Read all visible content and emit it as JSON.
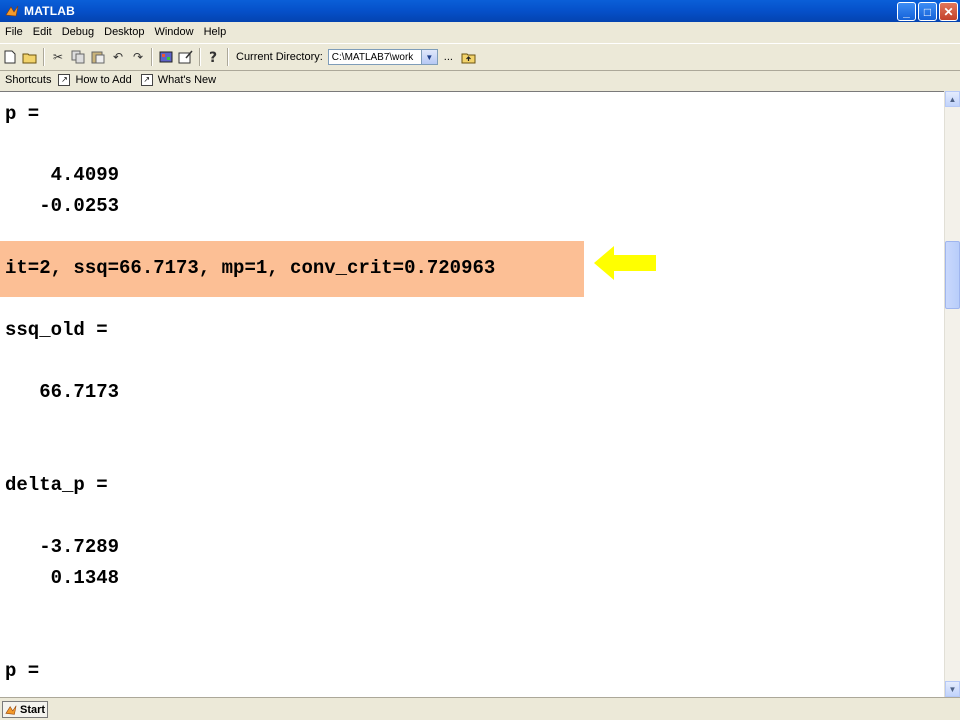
{
  "window": {
    "title": "MATLAB",
    "minimize": "_",
    "maximize": "□",
    "close": "✕"
  },
  "menu": [
    "File",
    "Edit",
    "Debug",
    "Desktop",
    "Window",
    "Help"
  ],
  "toolbar": {
    "current_directory_label": "Current Directory:",
    "current_directory_value": "C:\\MATLAB7\\work",
    "browse_label": "..."
  },
  "shortcuts": {
    "label": "Shortcuts",
    "items": [
      "How to Add",
      "What's New"
    ]
  },
  "command_window": {
    "lines": [
      "p =",
      "    4.4099",
      "   -0.0253",
      "it=2, ssq=66.7173, mp=1, conv_crit=0.720963",
      "ssq_old =",
      "   66.7173",
      "delta_p =",
      "   -3.7289",
      "    0.1348",
      "p ="
    ],
    "highlight_color": "#fcbf95",
    "arrow_color": "#ffff00"
  },
  "statusbar": {
    "start_label": "Start"
  }
}
